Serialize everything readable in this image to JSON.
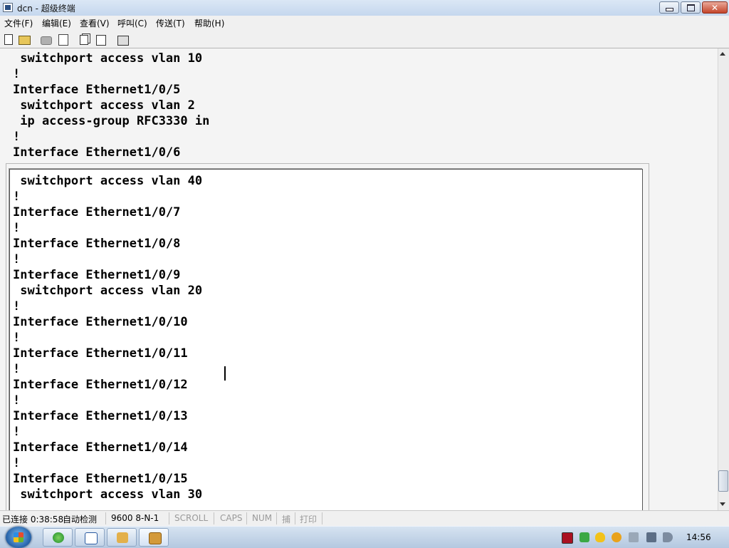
{
  "window": {
    "title": "dcn - 超级终端"
  },
  "menu": [
    "文件(F)",
    "编辑(E)",
    "查看(V)",
    "呼叫(C)",
    "传送(T)",
    "帮助(H)"
  ],
  "toolbar_icons": [
    "new-file-icon",
    "open-folder-icon",
    "disconnect-icon",
    "properties-icon",
    "copy-icon",
    "send-icon",
    "print-icon"
  ],
  "terminal": {
    "outer_lines": [
      " switchport access vlan 10",
      "!",
      "Interface Ethernet1/0/5",
      " switchport access vlan 2",
      " ip access-group RFC3330 in",
      "!",
      "Interface Ethernet1/0/6"
    ],
    "inner_lines": [
      " switchport access vlan 40",
      "!",
      "Interface Ethernet1/0/7",
      "!",
      "Interface Ethernet1/0/8",
      "!",
      "Interface Ethernet1/0/9",
      " switchport access vlan 20",
      "!",
      "Interface Ethernet1/0/10",
      "!",
      "Interface Ethernet1/0/11",
      "!",
      "Interface Ethernet1/0/12",
      "!",
      "Interface Ethernet1/0/13",
      "!",
      "Interface Ethernet1/0/14",
      "!",
      "Interface Ethernet1/0/15",
      " switchport access vlan 30"
    ]
  },
  "status": {
    "connection": "已连接 0:38:58",
    "detect": "自动检测",
    "baud": "9600 8-N-1",
    "scroll": "SCROLL",
    "caps": "CAPS",
    "num": "NUM",
    "capture": "捕",
    "print": "打印"
  },
  "taskbar": {
    "clock": "14:56",
    "tray_icons": [
      "network-monitor-icon",
      "shield-icon",
      "security-icon",
      "usb-icon",
      "safely-remove-icon",
      "network-icon",
      "volume-icon"
    ]
  },
  "colors": {
    "titlebar": "#c5d7ee",
    "terminal_bg": "#f4f4f4",
    "inner_pane_bg": "#ffffff",
    "close": "#c4452a"
  }
}
